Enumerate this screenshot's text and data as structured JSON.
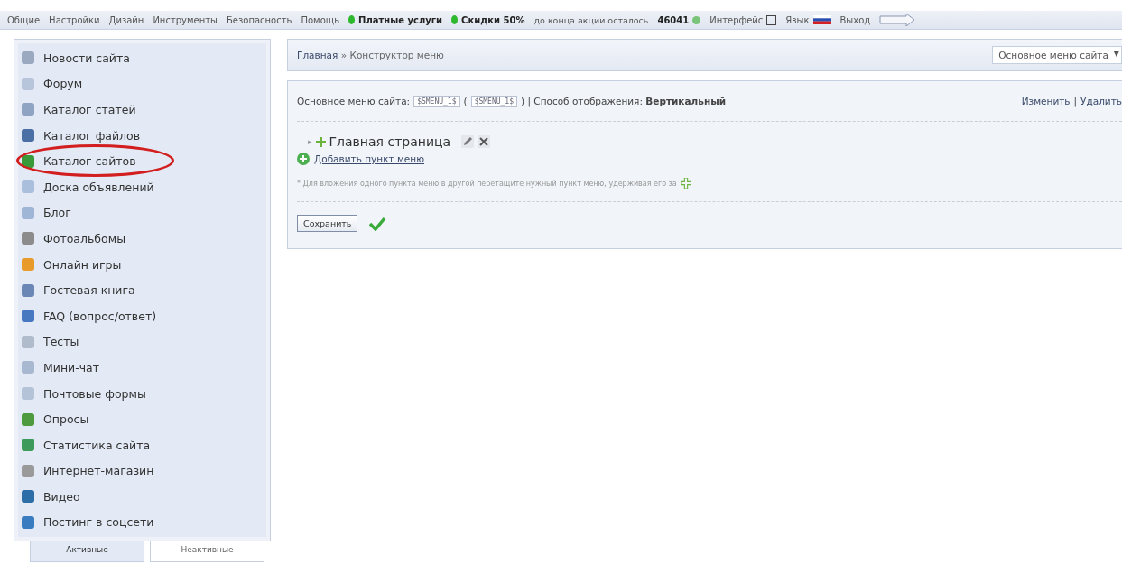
{
  "top_menu": [
    {
      "kind": "link",
      "label": "Общие"
    },
    {
      "kind": "link",
      "label": "Настройки"
    },
    {
      "kind": "link",
      "label": "Дизайн"
    },
    {
      "kind": "link",
      "label": "Инструменты"
    },
    {
      "kind": "link",
      "label": "Безопасность"
    },
    {
      "kind": "link",
      "label": "Помощь"
    },
    {
      "kind": "promo",
      "label": "Платные услуги"
    },
    {
      "kind": "promo",
      "label": "Скидки 50%"
    },
    {
      "kind": "note",
      "label": "до конца акции осталось"
    },
    {
      "kind": "counter",
      "label": "46041"
    },
    {
      "kind": "checkbox-link",
      "label": "Интерфейс"
    },
    {
      "kind": "flag-link",
      "label": "Язык"
    },
    {
      "kind": "link",
      "label": "Выход"
    }
  ],
  "sidebar": {
    "items": [
      {
        "label": "Новости сайта",
        "highlighted": false
      },
      {
        "label": "Форум",
        "highlighted": false
      },
      {
        "label": "Каталог статей",
        "highlighted": false
      },
      {
        "label": "Каталог файлов",
        "highlighted": false
      },
      {
        "label": "Каталог сайтов",
        "highlighted": true
      },
      {
        "label": "Доска объявлений",
        "highlighted": false
      },
      {
        "label": "Блог",
        "highlighted": false
      },
      {
        "label": "Фотоальбомы",
        "highlighted": false
      },
      {
        "label": "Онлайн игры",
        "highlighted": false
      },
      {
        "label": "Гостевая книга",
        "highlighted": false
      },
      {
        "label": "FAQ (вопрос/ответ)",
        "highlighted": false
      },
      {
        "label": "Тесты",
        "highlighted": false
      },
      {
        "label": "Мини-чат",
        "highlighted": false
      },
      {
        "label": "Почтовые формы",
        "highlighted": false
      },
      {
        "label": "Опросы",
        "highlighted": false
      },
      {
        "label": "Статистика сайта",
        "highlighted": false
      },
      {
        "label": "Интернет-магазин",
        "highlighted": false
      },
      {
        "label": "Видео",
        "highlighted": false
      },
      {
        "label": "Постинг в соцсети",
        "highlighted": false
      }
    ],
    "tabs": [
      {
        "label": "Активные",
        "selected": true
      },
      {
        "label": "Неактивные",
        "selected": false
      }
    ]
  },
  "breadcrumb": {
    "home": "Главная",
    "separator": "»",
    "current": "Конструктор меню"
  },
  "menu_select": {
    "value": "Основное меню сайта",
    "caret": "▼"
  },
  "menu_info": {
    "label": "Основное меню сайта:",
    "code": "$SMENU_1$",
    "paren_open": "(",
    "code_alt": "$SMENU_1$",
    "mode_label": ") | Способ отображения:",
    "mode": "Вертикальный",
    "edit": "Изменить",
    "links_separator": "|",
    "delete": "Удалить"
  },
  "menu_items": [
    {
      "expander": "▸",
      "label": "Главная страница"
    }
  ],
  "add_item": "Добавить пункт меню",
  "hint": "* Для вложения одного пункта меню в другой перетащите нужный пункт меню, удерживая его за",
  "save_button": "Сохранить"
}
